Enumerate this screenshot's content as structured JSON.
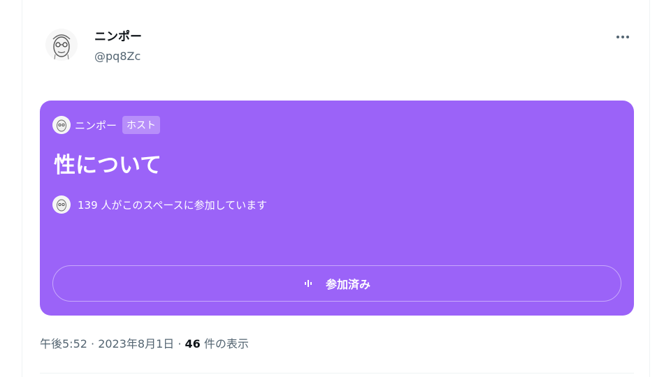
{
  "tweet": {
    "author": {
      "display_name": "ニンポー",
      "handle": "@pq8Zc"
    },
    "more_icon": "more-horizontal-icon",
    "space": {
      "host_name": "ニンポー",
      "host_badge": "ホスト",
      "title": "性について",
      "listener_text": "139 人がこのスペースに参加しています",
      "joined_label": "参加済み",
      "card_color": "#9b63f8"
    },
    "timestamp": "午後5:52 · 2023年8月1日 · ",
    "views_count": "46",
    "views_label": " 件の表示"
  }
}
